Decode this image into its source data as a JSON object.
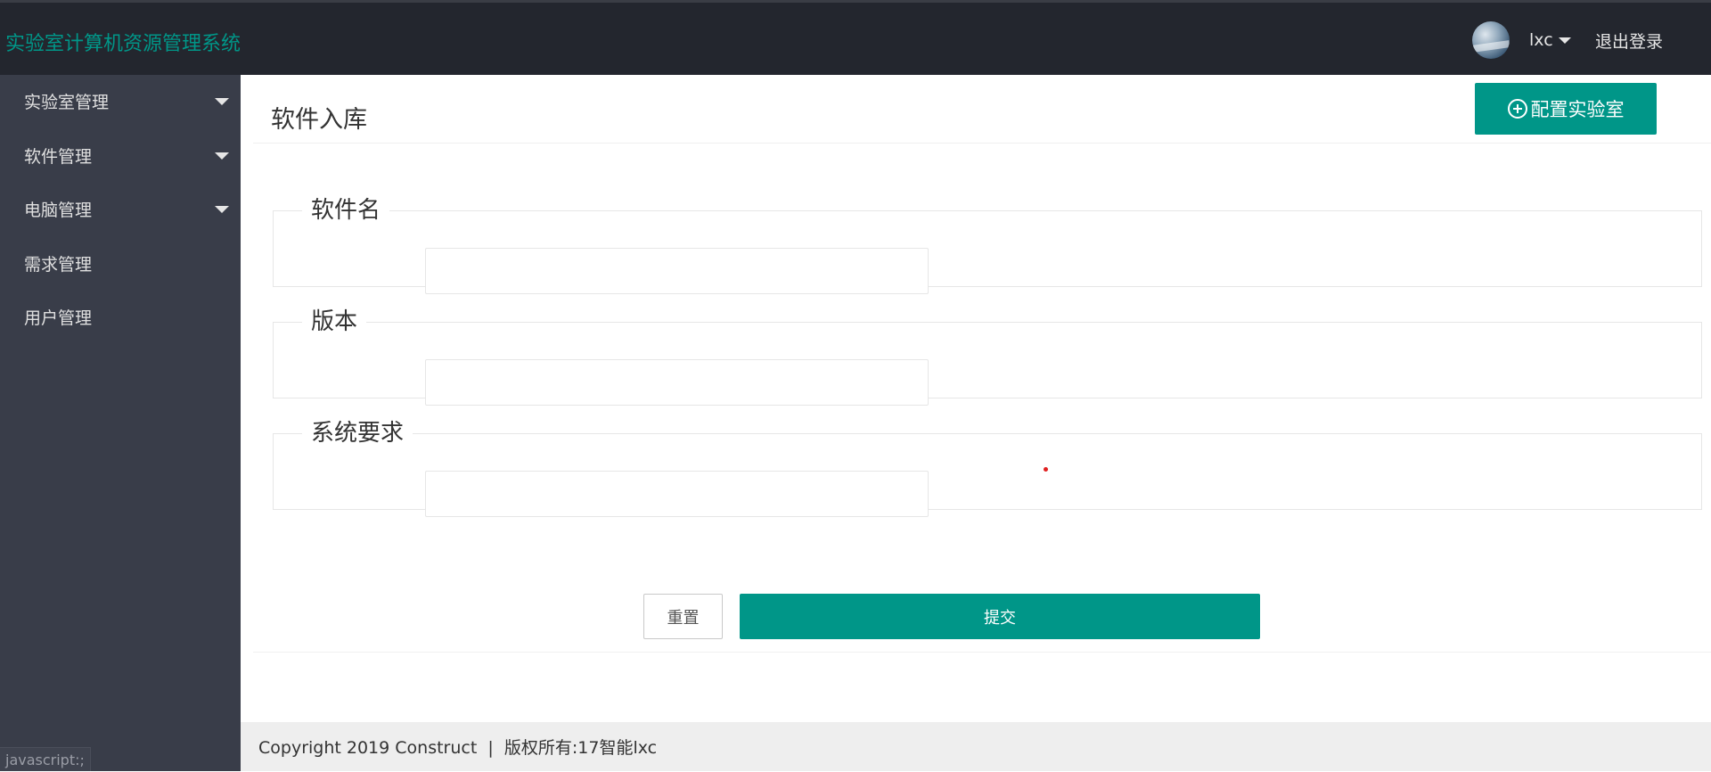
{
  "header": {
    "app_title": "实验室计算机资源管理系统",
    "username": "lxc",
    "logout_label": "退出登录"
  },
  "sidebar": {
    "items": [
      {
        "label": "实验室管理",
        "has_submenu": true
      },
      {
        "label": "软件管理",
        "has_submenu": true
      },
      {
        "label": "电脑管理",
        "has_submenu": true
      },
      {
        "label": "需求管理",
        "has_submenu": false
      },
      {
        "label": "用户管理",
        "has_submenu": false
      }
    ]
  },
  "status_bar": {
    "link_preview": "javascript:;"
  },
  "main": {
    "page_title": "软件入库",
    "config_button_label": "配置实验室",
    "form": {
      "fields": [
        {
          "legend": "软件名",
          "value": "",
          "placeholder": ""
        },
        {
          "legend": "版本",
          "value": "",
          "placeholder": ""
        },
        {
          "legend": "系统要求",
          "value": "",
          "placeholder": ""
        }
      ],
      "reset_label": "重置",
      "submit_label": "提交"
    }
  },
  "footer": {
    "copyright": "Copyright 2019 Construct  |  版权所有:17智能lxc"
  },
  "colors": {
    "accent": "#009688",
    "header_bg": "#23262e",
    "sidebar_bg": "#393d49",
    "footer_bg": "#eeeeee"
  },
  "icons": {
    "config_button": "plus-circle-icon",
    "user_dropdown": "caret-down-icon",
    "submenu": "caret-down-icon"
  }
}
